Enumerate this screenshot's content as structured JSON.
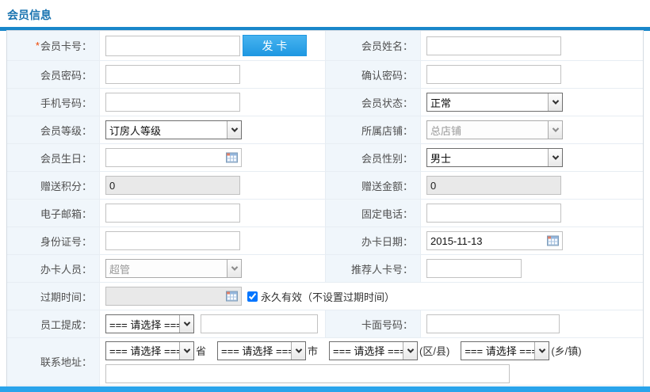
{
  "header": {
    "title": "会员信息"
  },
  "colors": {
    "title_blue": "#1873b0",
    "header_bar_blue": "#1987ca",
    "button_blue": "#2aa3ea",
    "bottom_bar_blue": "#2aa4eb",
    "label_cell_bg": "#f0f6fb",
    "required_star": "#ee4400"
  },
  "buttons": {
    "issue_card": "发 卡"
  },
  "icons": {
    "calendar": "calendar-icon",
    "chevron": "chevron-down-icon"
  },
  "fields": {
    "card_no": {
      "label": "会员卡号：",
      "required_mark": "*",
      "value": ""
    },
    "member_name": {
      "label": "会员姓名：",
      "value": ""
    },
    "password": {
      "label": "会员密码：",
      "value": ""
    },
    "confirm_password": {
      "label": "确认密码：",
      "value": ""
    },
    "mobile": {
      "label": "手机号码：",
      "value": ""
    },
    "status": {
      "label": "会员状态：",
      "value": "正常"
    },
    "level": {
      "label": "会员等级：",
      "value": "订房人等级"
    },
    "store": {
      "label": "所属店铺：",
      "value": "总店铺"
    },
    "birthday": {
      "label": "会员生日：",
      "value": ""
    },
    "gender": {
      "label": "会员性别：",
      "value": "男士"
    },
    "bonus_points": {
      "label": "赠送积分：",
      "value": "0"
    },
    "bonus_amount": {
      "label": "赠送金额：",
      "value": "0"
    },
    "email": {
      "label": "电子邮箱：",
      "value": ""
    },
    "landline": {
      "label": "固定电话：",
      "value": ""
    },
    "id_number": {
      "label": "身份证号：",
      "value": ""
    },
    "card_date": {
      "label": "办卡日期：",
      "value": "2015-11-13"
    },
    "operator": {
      "label": "办卡人员：",
      "value": "超管"
    },
    "referrer_card_no": {
      "label": "推荐人卡号：",
      "value": ""
    },
    "expiry_time": {
      "label": "过期时间：",
      "value": "",
      "checkbox_label": "永久有效（不设置过期时间）",
      "checkbox_checked": "checked"
    },
    "staff_commission": {
      "label": "员工提成：",
      "select_value": "=== 请选择 ===",
      "value": ""
    },
    "card_face_no": {
      "label": "卡面号码：",
      "value": ""
    },
    "address": {
      "label": "联系地址：",
      "province": {
        "select_value": "=== 请选择 ===",
        "suffix": "省"
      },
      "city": {
        "select_value": "=== 请选择 ===",
        "suffix": "市"
      },
      "district": {
        "select_value": "=== 请选择 ===",
        "suffix": "(区/县)"
      },
      "town": {
        "select_value": "=== 请选择 ===",
        "suffix": "(乡/镇)"
      },
      "detail_value": ""
    }
  }
}
